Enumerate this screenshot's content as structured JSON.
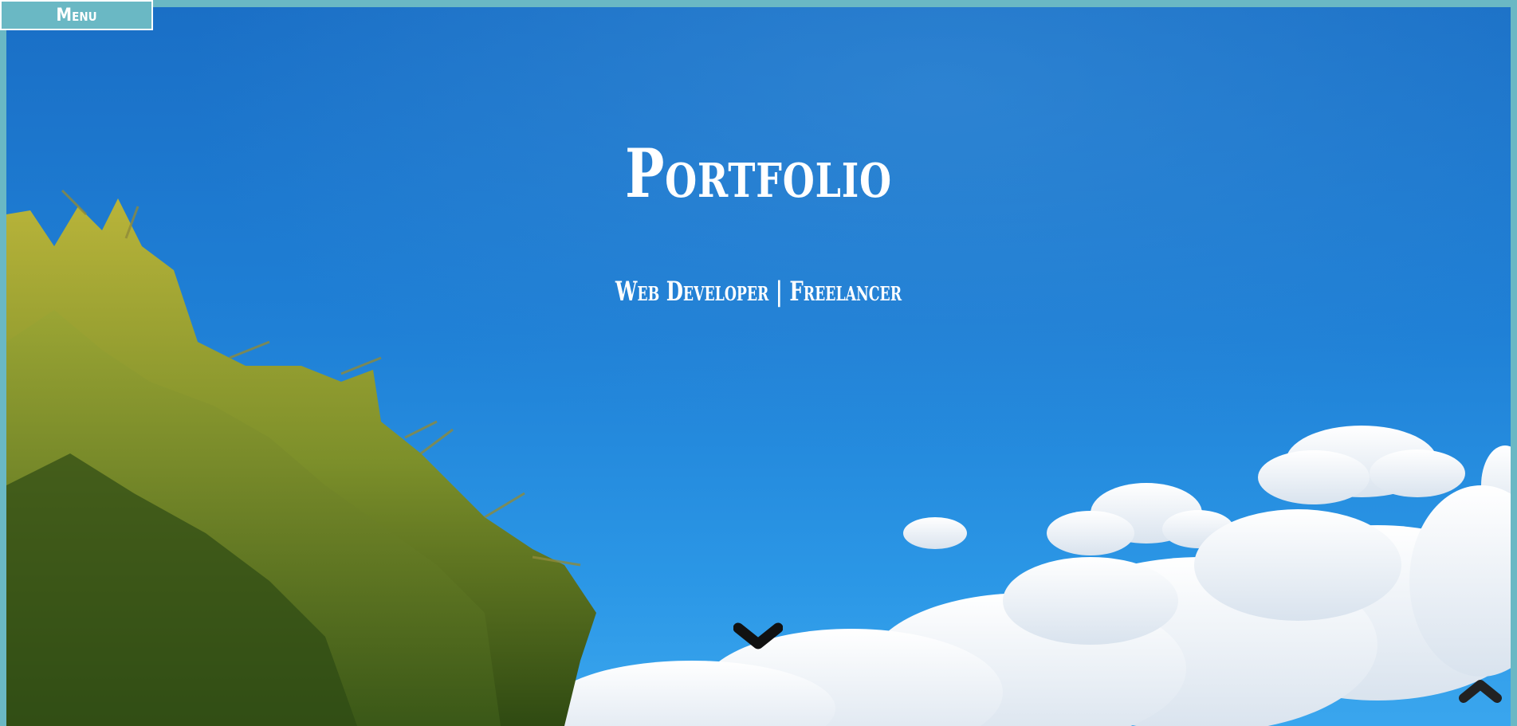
{
  "nav": {
    "menu_label": "Menu"
  },
  "hero": {
    "title": "Portfolio",
    "subtitle": "Web Developer | Freelancer",
    "scroll_icon": "chevron-down-icon"
  },
  "footer": {
    "back_to_top_icon": "chevron-up-icon"
  },
  "colors": {
    "accent": "#6ab8c4",
    "sky_top": "#1a6fc6",
    "sky_bottom": "#3aa6ee",
    "text": "#ffffff",
    "icon": "#1f1f1f"
  }
}
